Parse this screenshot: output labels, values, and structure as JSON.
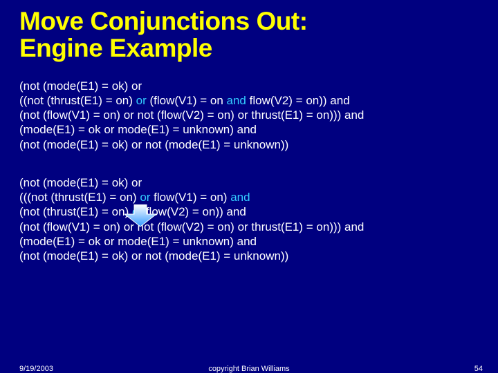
{
  "title_line1": "Move Conjunctions Out:",
  "title_line2": "Engine Example",
  "block1": {
    "l1a": "(not (mode(E1) = ok) or",
    "l2a": "   ((not (thrust(E1) = on) ",
    "l2b": "or",
    "l2c": " (flow(V1) = on ",
    "l2d": "and",
    "l2e": " flow(V2) = on)) and",
    "l3a": "    (not (flow(V1) = on) or not (flow(V2) = on) or thrust(E1) = on))) and",
    "l4a": "(mode(E1) = ok or mode(E1) = unknown) and",
    "l5a": "(not (mode(E1) = ok) or not (mode(E1) = unknown))"
  },
  "block2": {
    "l1a": "(not (mode(E1) = ok) or",
    "l2a": "   (((not (thrust(E1) = on) ",
    "l2b": "or",
    "l2c": " flow(V1) = on) ",
    "l2d": "and",
    "l3a": "     (not (thrust(E1) = on) ",
    "l3b": "or",
    "l3c": " flow(V2) = on)) and",
    "l4a": "    (not (flow(V1) = on) or not (flow(V2) = on) or thrust(E1) = on))) and",
    "l5a": "(mode(E1) = ok or mode(E1) = unknown) and",
    "l6a": "(not (mode(E1) = ok) or not (mode(E1) = unknown))"
  },
  "footer": {
    "date": "9/19/2003",
    "copyright": "copyright Brian Williams",
    "page": "54"
  }
}
